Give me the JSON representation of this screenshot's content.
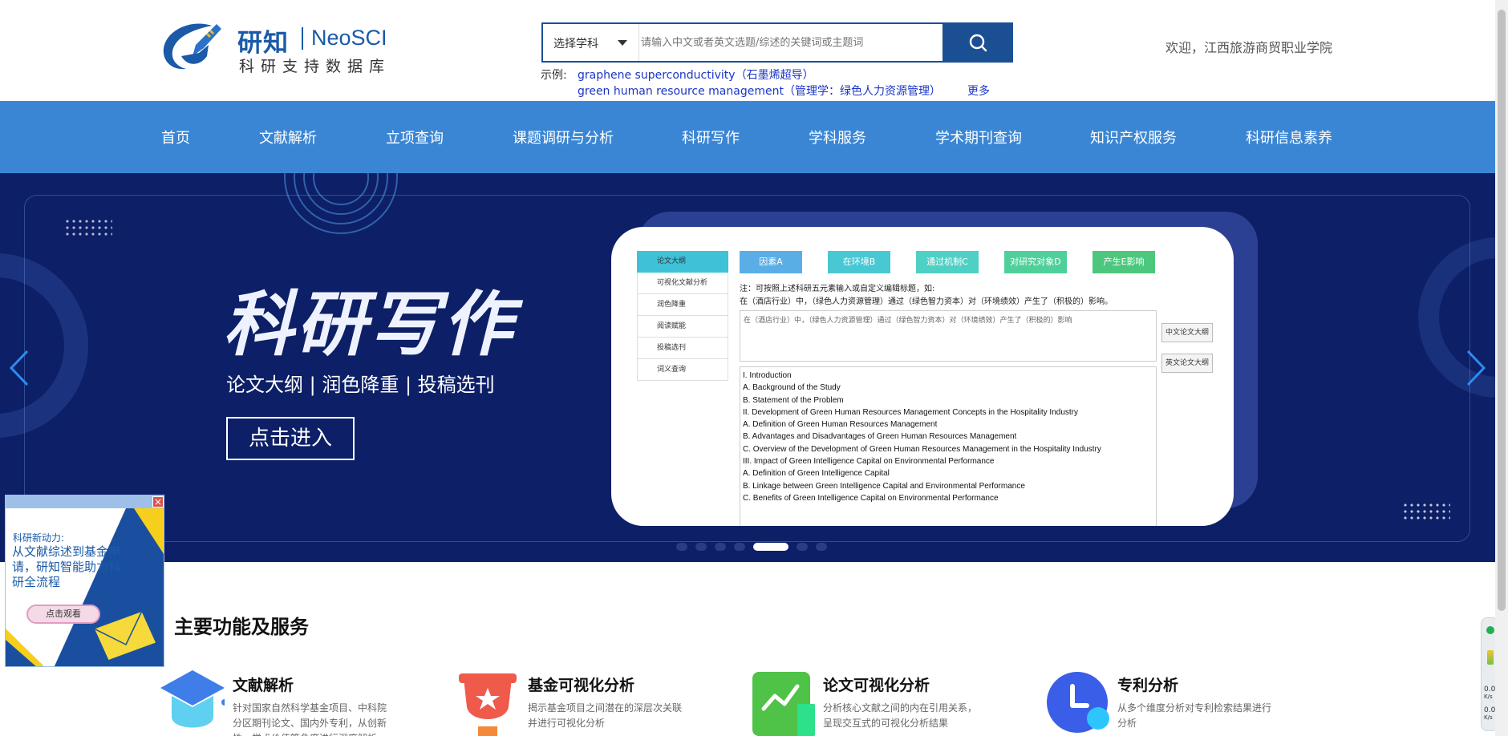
{
  "header": {
    "logo_cn": "研知",
    "logo_en": "NeoSCI",
    "logo_sub": "科研支持数据库",
    "search": {
      "subject_select": "选择学科",
      "placeholder": "请输入中文或者英文选题/综述的关键词或主题词"
    },
    "examples": {
      "label": "示例:",
      "items": [
        "graphene superconductivity（石墨烯超导）",
        "green human resource management（管理学：绿色人力资源管理）"
      ],
      "more": "更多"
    },
    "welcome": "欢迎，江西旅游商贸职业学院"
  },
  "nav": {
    "items": [
      "首页",
      "文献解析",
      "立项查询",
      "课题调研与分析",
      "科研写作",
      "学科服务",
      "学术期刊查询",
      "知识产权服务",
      "科研信息素养"
    ]
  },
  "banner": {
    "title": "科研写作",
    "subtitle": "论文大纲 | 润色降重 | 投稿选刊",
    "button": "点击进入",
    "slide_count": 7,
    "active_slide": 5,
    "panel": {
      "menu": [
        "论文大纲",
        "可视化文献分析",
        "润色降重",
        "阅读赋能",
        "投稿选刊",
        "词义查询"
      ],
      "tags": [
        {
          "label": "因素A",
          "color": "#5aaee6"
        },
        {
          "label": "在环境B",
          "color": "#48c8d3"
        },
        {
          "label": "通过机制C",
          "color": "#4fd0c4"
        },
        {
          "label": "对研究对象D",
          "color": "#4fcf9a"
        },
        {
          "label": "产生E影响",
          "color": "#4dc77e"
        }
      ],
      "note_line1": "注：可按照上述科研五元素输入或自定义编辑标题，如:",
      "note_line2": "在（酒店行业）中，（绿色人力资源管理）通过（绿色智力资本）对（环境绩效）产生了（积极的）影响。",
      "textarea": "在（酒店行业）中，（绿色人力资源管理）通过（绿色智力资本）对（环境绩效）产生了（积极的）影响",
      "btn_cn": "中文论文大纲",
      "btn_en": "英文论文大纲",
      "outline": [
        "I. Introduction",
        "A. Background of the Study",
        "B. Statement of the Problem",
        "II. Development of Green Human Resources Management Concepts in the Hospitality Industry",
        "A. Definition of Green Human Resources Management",
        "B. Advantages and Disadvantages of Green Human Resources Management",
        "C. Overview of the Development of Green Human Resources Management in the Hospitality Industry",
        "III. Impact of Green Intelligence Capital on Environmental Performance",
        "A. Definition of Green Intelligence Capital",
        "B. Linkage between Green Intelligence Capital and Environmental Performance",
        "C. Benefits of Green Intelligence Capital on Environmental Performance"
      ]
    }
  },
  "popup": {
    "kicker": "科研新动力:",
    "text": "从文献综述到基金申请，研知智能助力科研全流程",
    "button": "点击观看",
    "close": "×"
  },
  "services": {
    "title": "主要功能及服务",
    "items": [
      {
        "title": "文献解析",
        "desc": "针对国家自然科学基金项目、中科院分区期刊论文、国内外专利，从创新性、学术价值等角度进行深度解析"
      },
      {
        "title": "基金可视化分析",
        "desc": "揭示基金项目之间潜在的深层次关联并进行可视化分析"
      },
      {
        "title": "论文可视化分析",
        "desc": "分析核心文献之间的内在引用关系，呈现交互式的可视化分析结果"
      },
      {
        "title": "专利分析",
        "desc": "从多个维度分析对专利检索结果进行分析"
      }
    ]
  },
  "widget": {
    "up": "0.0",
    "up_unit": "K/s",
    "down": "0.0",
    "down_unit": "K/s"
  }
}
